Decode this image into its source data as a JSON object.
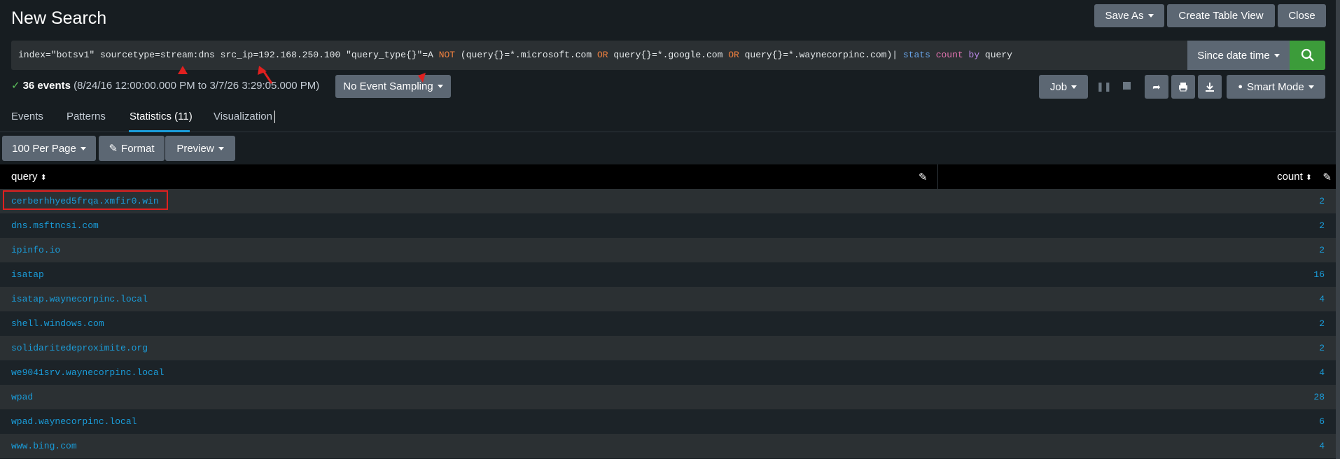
{
  "header": {
    "title": "New Search",
    "save_as": "Save As",
    "create_table_view": "Create Table View",
    "close": "Close"
  },
  "search": {
    "parts": [
      {
        "t": "index=\"botsv1\" sourcetype=stream:dns src_ip=192.168.250.100 \"query_type{}\"=A ",
        "c": ""
      },
      {
        "t": "NOT",
        "c": "orange"
      },
      {
        "t": " (query{}=*.microsoft.com ",
        "c": ""
      },
      {
        "t": "OR",
        "c": "orange"
      },
      {
        "t": " query{}=*.google.com ",
        "c": ""
      },
      {
        "t": "OR",
        "c": "orange"
      },
      {
        "t": " query{}=*.waynecorpinc.com)| ",
        "c": ""
      },
      {
        "t": "stats",
        "c": "blue"
      },
      {
        "t": " ",
        "c": ""
      },
      {
        "t": "count",
        "c": "pink"
      },
      {
        "t": " ",
        "c": ""
      },
      {
        "t": "by",
        "c": "purple"
      },
      {
        "t": " query",
        "c": ""
      }
    ],
    "time_range": "Since date time",
    "search_icon": "search-icon"
  },
  "status": {
    "event_count": "36 events",
    "range": "(8/24/16 12:00:00.000 PM to 3/7/26 3:29:05.000 PM)",
    "sampling": "No Event Sampling",
    "job": "Job",
    "mode": "Smart Mode"
  },
  "tabs": [
    {
      "label": "Events"
    },
    {
      "label": "Patterns"
    },
    {
      "label": "Statistics (11)"
    },
    {
      "label": "Visualization"
    }
  ],
  "results_toolbar": {
    "per_page": "100 Per Page",
    "format": "Format",
    "preview": "Preview"
  },
  "table": {
    "columns": [
      "query",
      "count"
    ],
    "rows": [
      {
        "query": "cerberhhyed5frqa.xmfir0.win",
        "count": "2"
      },
      {
        "query": "dns.msftncsi.com",
        "count": "2"
      },
      {
        "query": "ipinfo.io",
        "count": "2"
      },
      {
        "query": "isatap",
        "count": "16"
      },
      {
        "query": "isatap.waynecorpinc.local",
        "count": "4"
      },
      {
        "query": "shell.windows.com",
        "count": "2"
      },
      {
        "query": "solidaritedeproximite.org",
        "count": "2"
      },
      {
        "query": "we9041srv.waynecorpinc.local",
        "count": "4"
      },
      {
        "query": "wpad",
        "count": "28"
      },
      {
        "query": "wpad.waynecorpinc.local",
        "count": "6"
      },
      {
        "query": "www.bing.com",
        "count": "4"
      }
    ]
  },
  "colors": {
    "accent": "#1a9cd9",
    "search_button": "#3c9c3a",
    "highlight": "#e0201f"
  }
}
